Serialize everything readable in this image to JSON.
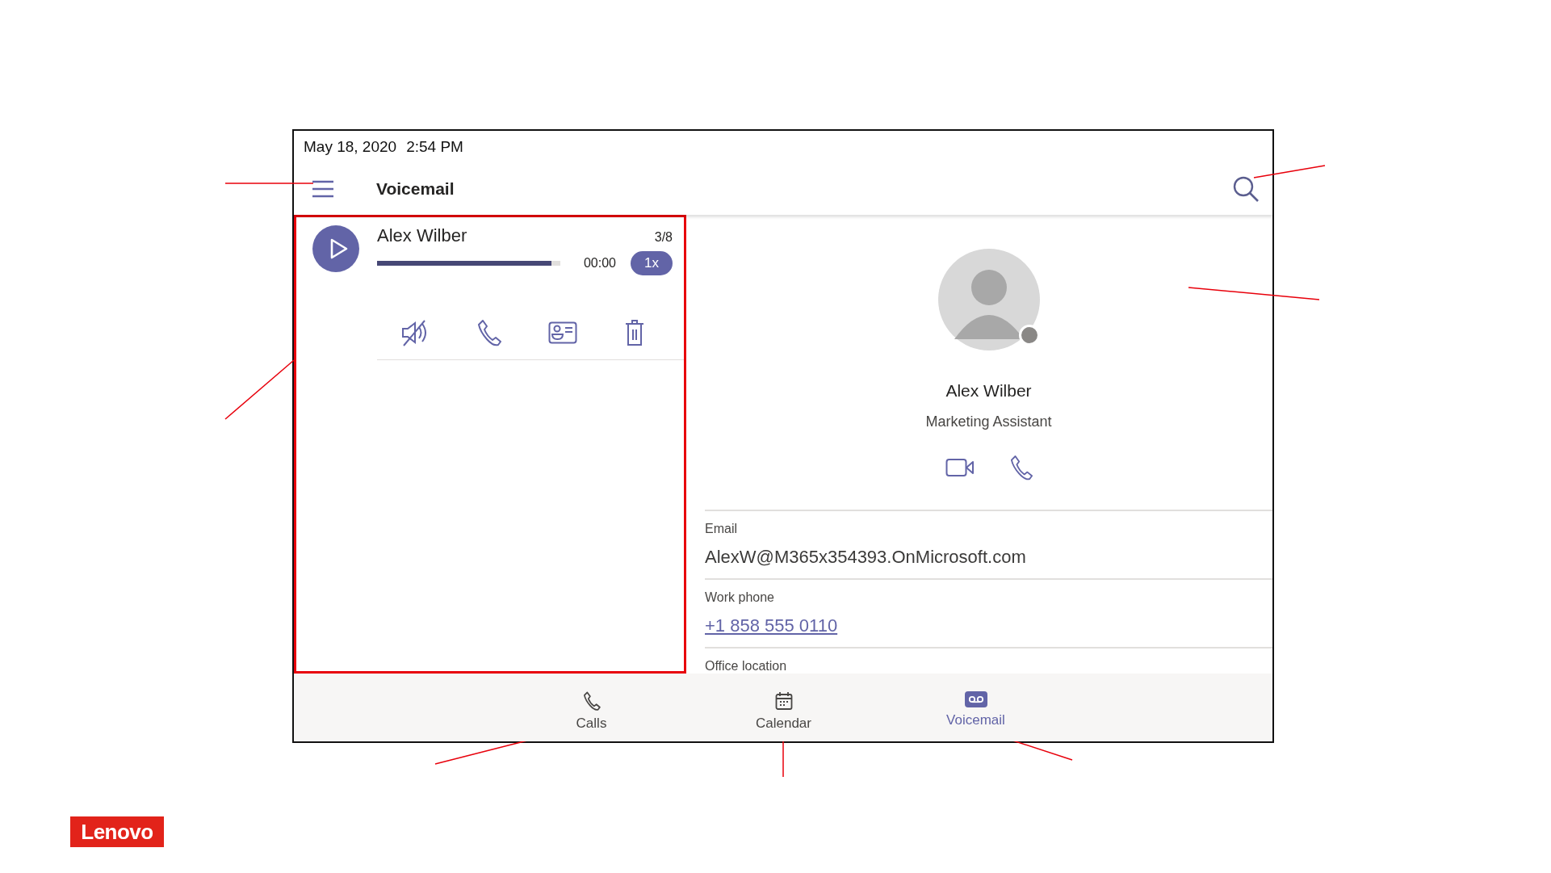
{
  "status_bar": {
    "date": "May 18, 2020",
    "time": "2:54 PM"
  },
  "header": {
    "title": "Voicemail"
  },
  "voicemail": {
    "caller": "Alex Wilber",
    "position": "3/8",
    "elapsed": "00:00",
    "speed": "1x",
    "level": 0.95
  },
  "contact": {
    "name": "Alex Wilber",
    "title": "Marketing Assistant",
    "fields": [
      {
        "label": "Email",
        "value": "AlexW@M365x354393.OnMicrosoft.com",
        "kind": "text"
      },
      {
        "label": "Work phone",
        "value": "+1 858 555 0110",
        "kind": "link"
      },
      {
        "label": "Office location"
      }
    ]
  },
  "nav": [
    {
      "label": "Calls",
      "kind": "phone",
      "selected": false
    },
    {
      "label": "Calendar",
      "kind": "calendar",
      "selected": false
    },
    {
      "label": "Voicemail",
      "kind": "voicemail",
      "selected": true
    }
  ],
  "logo": {
    "text": "Lenovo"
  }
}
